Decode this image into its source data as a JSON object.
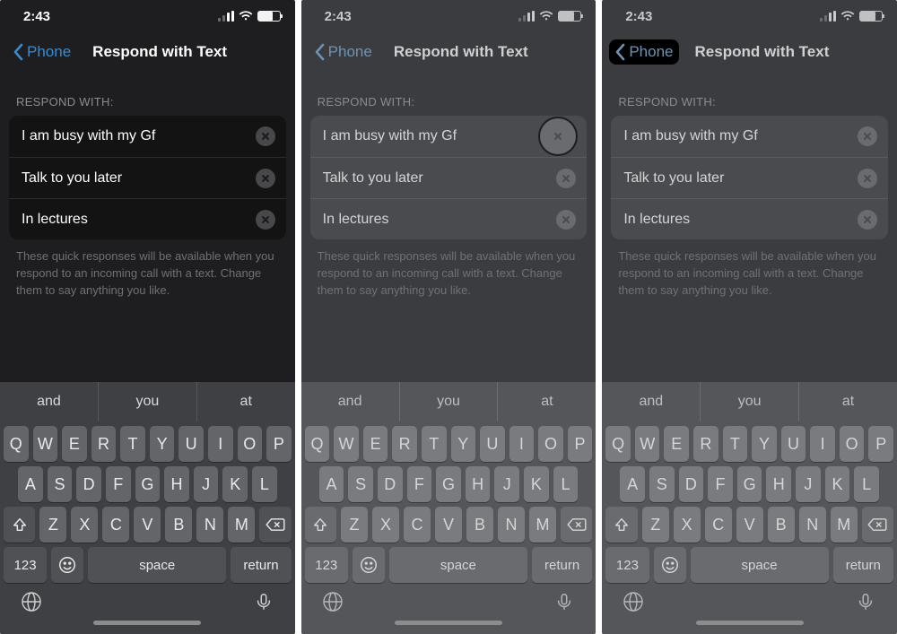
{
  "status": {
    "time": "2:43"
  },
  "nav": {
    "back": "Phone",
    "title": "Respond with Text"
  },
  "section": {
    "label": "RESPOND WITH:",
    "responses": [
      "I am busy with my Gf",
      "Talk to you later",
      "In lectures"
    ],
    "footnote": "These quick responses will be available when you respond to an incoming call with a text. Change them to say anything you like."
  },
  "keyboard": {
    "suggestions": [
      "and",
      "you",
      "at"
    ],
    "row1": [
      "Q",
      "W",
      "E",
      "R",
      "T",
      "Y",
      "U",
      "I",
      "O",
      "P"
    ],
    "row2": [
      "A",
      "S",
      "D",
      "F",
      "G",
      "H",
      "J",
      "K",
      "L"
    ],
    "row3": [
      "Z",
      "X",
      "C",
      "V",
      "B",
      "N",
      "M"
    ],
    "numKey": "123",
    "space": "space",
    "return": "return"
  },
  "screens": [
    {
      "dim": false,
      "backPressed": false,
      "clearBig": false
    },
    {
      "dim": true,
      "backPressed": false,
      "clearBig": true
    },
    {
      "dim": true,
      "backPressed": true,
      "clearBig": false
    }
  ]
}
